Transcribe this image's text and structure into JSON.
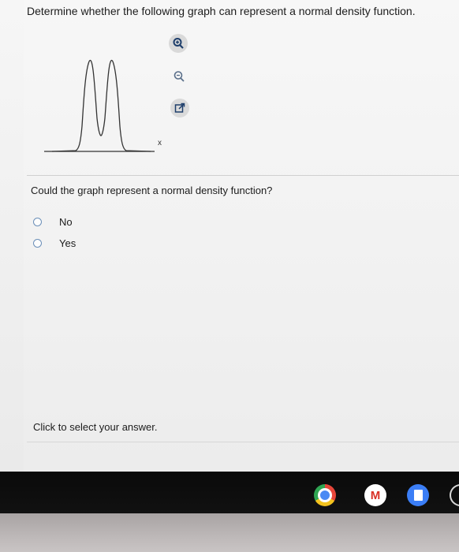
{
  "question": {
    "title": "Determine whether the following graph can represent a normal density function.",
    "graph": {
      "x_axis_label": "x"
    }
  },
  "toolbar": {
    "icons": [
      "zoom-in-icon",
      "zoom-out-icon",
      "popout-icon"
    ]
  },
  "prompt": "Could the graph represent a normal density function?",
  "options": [
    {
      "label": "No",
      "selected": false
    },
    {
      "label": "Yes",
      "selected": false
    }
  ],
  "instruction": "Click to select your answer.",
  "shelf": {
    "apps": [
      "chrome-icon",
      "gmail-icon",
      "docs-icon"
    ],
    "gmail_glyph": "M"
  },
  "colors": {
    "radio_border": "#6b8fb8",
    "taskbar": "#0a0a0a"
  }
}
